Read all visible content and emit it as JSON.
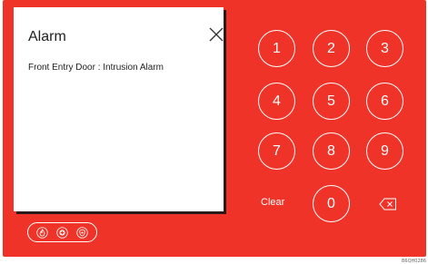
{
  "alarm": {
    "title": "Alarm",
    "message": "Front Entry Door : Intrusion Alarm"
  },
  "status_icons": [
    "fire-icon",
    "medical-icon",
    "police-shield-icon"
  ],
  "keypad": {
    "keys": [
      "1",
      "2",
      "3",
      "4",
      "5",
      "6",
      "7",
      "8",
      "9",
      "0"
    ],
    "clear_label": "Clear"
  },
  "footer": {
    "code": "B6QH0286"
  },
  "colors": {
    "panel": "#ef3328",
    "card": "#ffffff",
    "text": "#222222"
  }
}
